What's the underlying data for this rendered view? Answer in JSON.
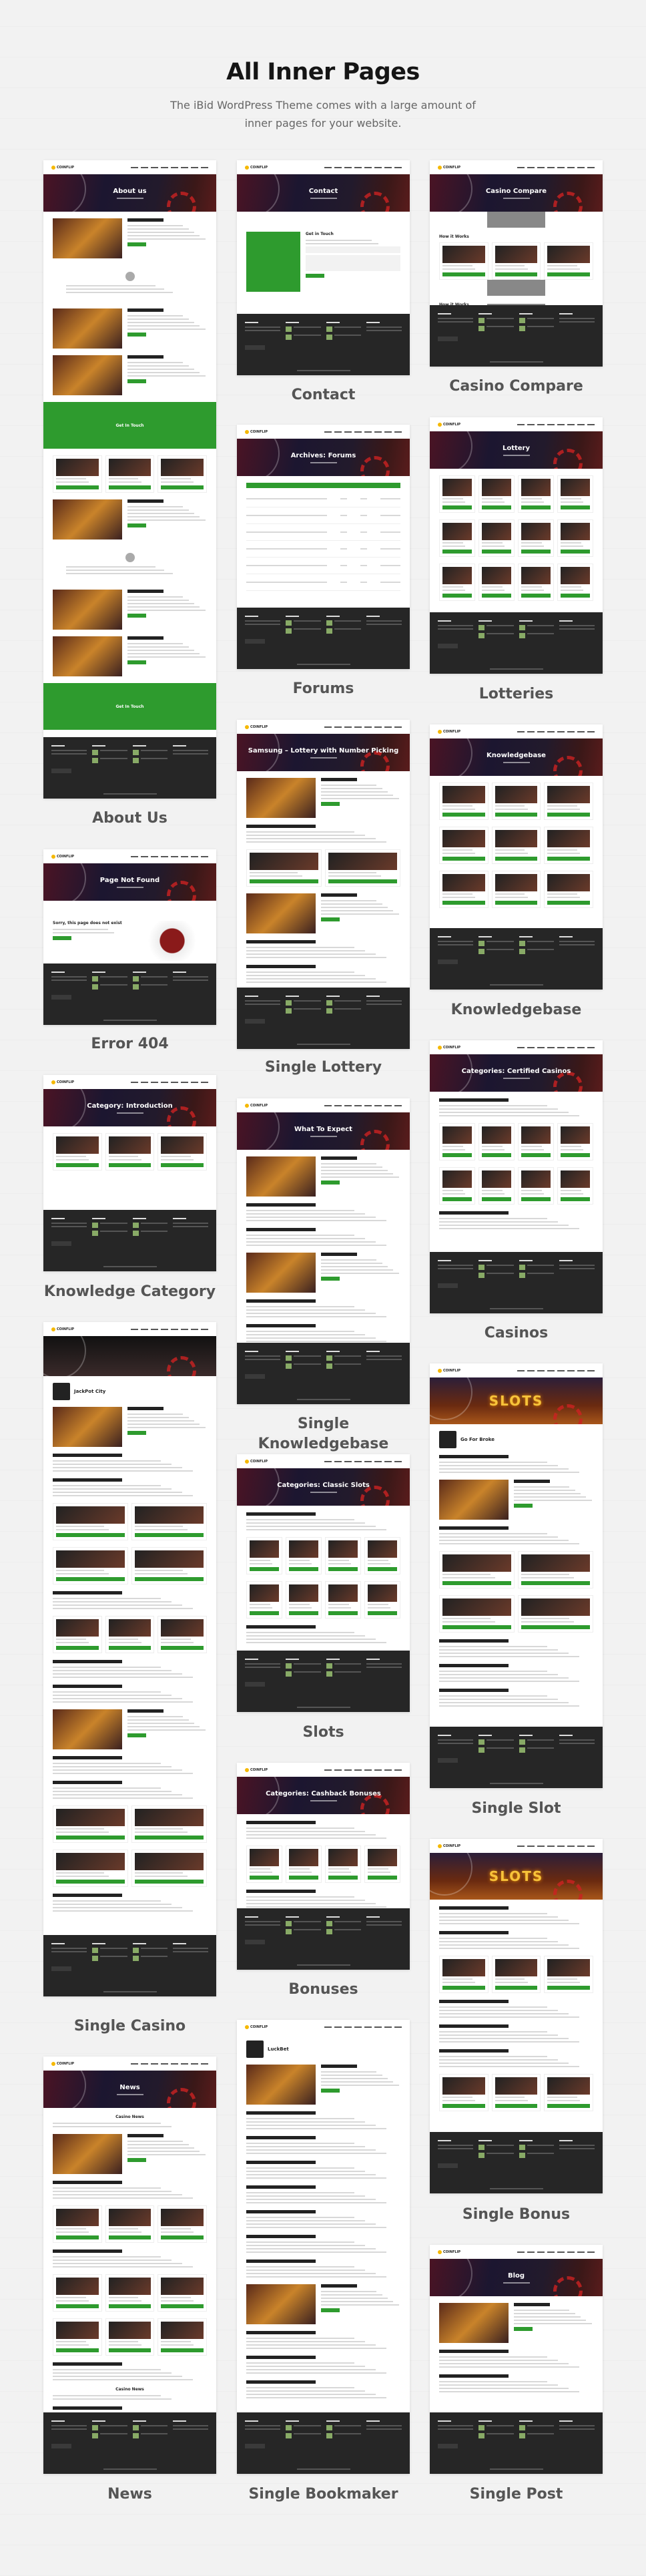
{
  "header": {
    "title": "All Inner Pages",
    "subtitle": "The iBid WordPress Theme comes with a large amount of inner pages for your website."
  },
  "theme": {
    "logo": "COINFLIP",
    "accent": "#2e9b2e",
    "footer_bg": "#262626",
    "background": "#f2f2f2"
  },
  "pages": [
    {
      "label": "About Us",
      "hero_title": "About us",
      "section": "Get In Touch"
    },
    {
      "label": "Error 404",
      "hero_title": "Page Not Found",
      "section": "Sorry, this page does not exist"
    },
    {
      "label": "Knowledge Category",
      "hero_title": "Category: Introduction"
    },
    {
      "label": "Single Casino",
      "hero_title": "",
      "section": "JackPot City"
    },
    {
      "label": "News",
      "hero_title": "News",
      "section": "Casino News"
    },
    {
      "label": "Contact",
      "hero_title": "Contact",
      "section": "Get in Touch"
    },
    {
      "label": "Forums",
      "hero_title": "Archives: Forums"
    },
    {
      "label": "Single Lottery",
      "hero_title": "Samsung – Lottery with Number Picking"
    },
    {
      "label": "Single Knowledgebase",
      "hero_title": "What To Expect"
    },
    {
      "label": "Slots",
      "hero_title": "Categories: Classic Slots"
    },
    {
      "label": "Bonuses",
      "hero_title": "Categories: Cashback Bonuses"
    },
    {
      "label": "Single Bookmaker",
      "hero_title": "",
      "section": "LuckBet"
    },
    {
      "label": "Casino Compare",
      "hero_title": "Casino Compare",
      "section": "How it Works"
    },
    {
      "label": "Lotteries",
      "hero_title": "Lottery"
    },
    {
      "label": "Knowledgebase",
      "hero_title": "Knowledgebase"
    },
    {
      "label": "Casinos",
      "hero_title": "Categories: Certified Casinos"
    },
    {
      "label": "Single Slot",
      "hero_title": "SLOTS",
      "section": "Go For Broke"
    },
    {
      "label": "Single Bonus",
      "hero_title": "SLOTS"
    },
    {
      "label": "Single Post",
      "hero_title": "Blog"
    }
  ]
}
